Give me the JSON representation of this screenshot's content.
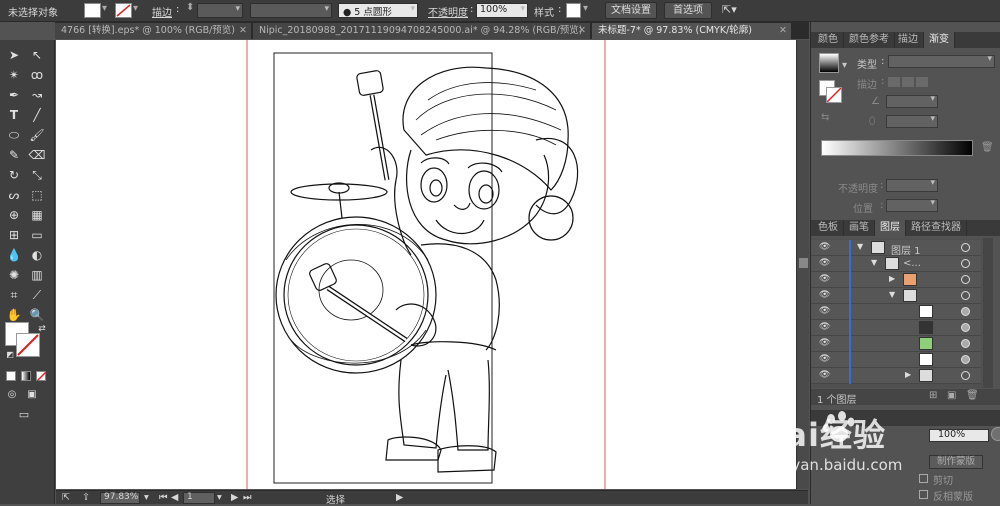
{
  "control_bar": {
    "selection_status": "未选择对象",
    "stroke_label": "描边",
    "brush_label": "● 5 点圆形",
    "opacity_label": "不透明度",
    "opacity_value": "100%",
    "style_label": "样式",
    "doc_setup_button": "文档设置",
    "preferences_button": "首选项"
  },
  "tabs": [
    {
      "label": "4766 [转换].eps* @ 100% (RGB/预览)",
      "active": false
    },
    {
      "label": "Nipic_20180988_20171119094708245000.ai* @ 94.28% (RGB/预览)",
      "active": false
    },
    {
      "label": "未标题-7* @ 97.83% (CMYK/轮廓)",
      "active": true
    }
  ],
  "status_bar": {
    "zoom": "97.83%",
    "page": "1",
    "tool_status": "选择"
  },
  "panels": {
    "top_tabs": [
      "颜色",
      "颜色参考",
      "描边",
      "渐变"
    ],
    "gradient": {
      "type_label": "类型",
      "stroke_label": "描边",
      "opacity_label": "不透明度",
      "position_label": "位置"
    },
    "layer_tabs": [
      "色板",
      "画笔",
      "图层",
      "路径查找器"
    ],
    "layers": [
      {
        "name": "图层 1",
        "level": 0
      },
      {
        "name": "<...",
        "level": 1
      },
      {
        "name": "",
        "level": 2
      },
      {
        "name": "",
        "level": 2
      },
      {
        "name": "",
        "level": 3
      },
      {
        "name": "",
        "level": 3
      },
      {
        "name": "",
        "level": 3
      },
      {
        "name": "",
        "level": 3
      },
      {
        "name": "",
        "level": 3
      }
    ],
    "layer_count": "1 个图层",
    "transparency": {
      "opacity_value": "100%",
      "make_mask_button": "制作蒙版",
      "clip_label": "剪切",
      "invert_label": "反相蒙版"
    }
  },
  "watermark": {
    "brand": "Bai经验",
    "url": "jingyan.baidu.com"
  }
}
